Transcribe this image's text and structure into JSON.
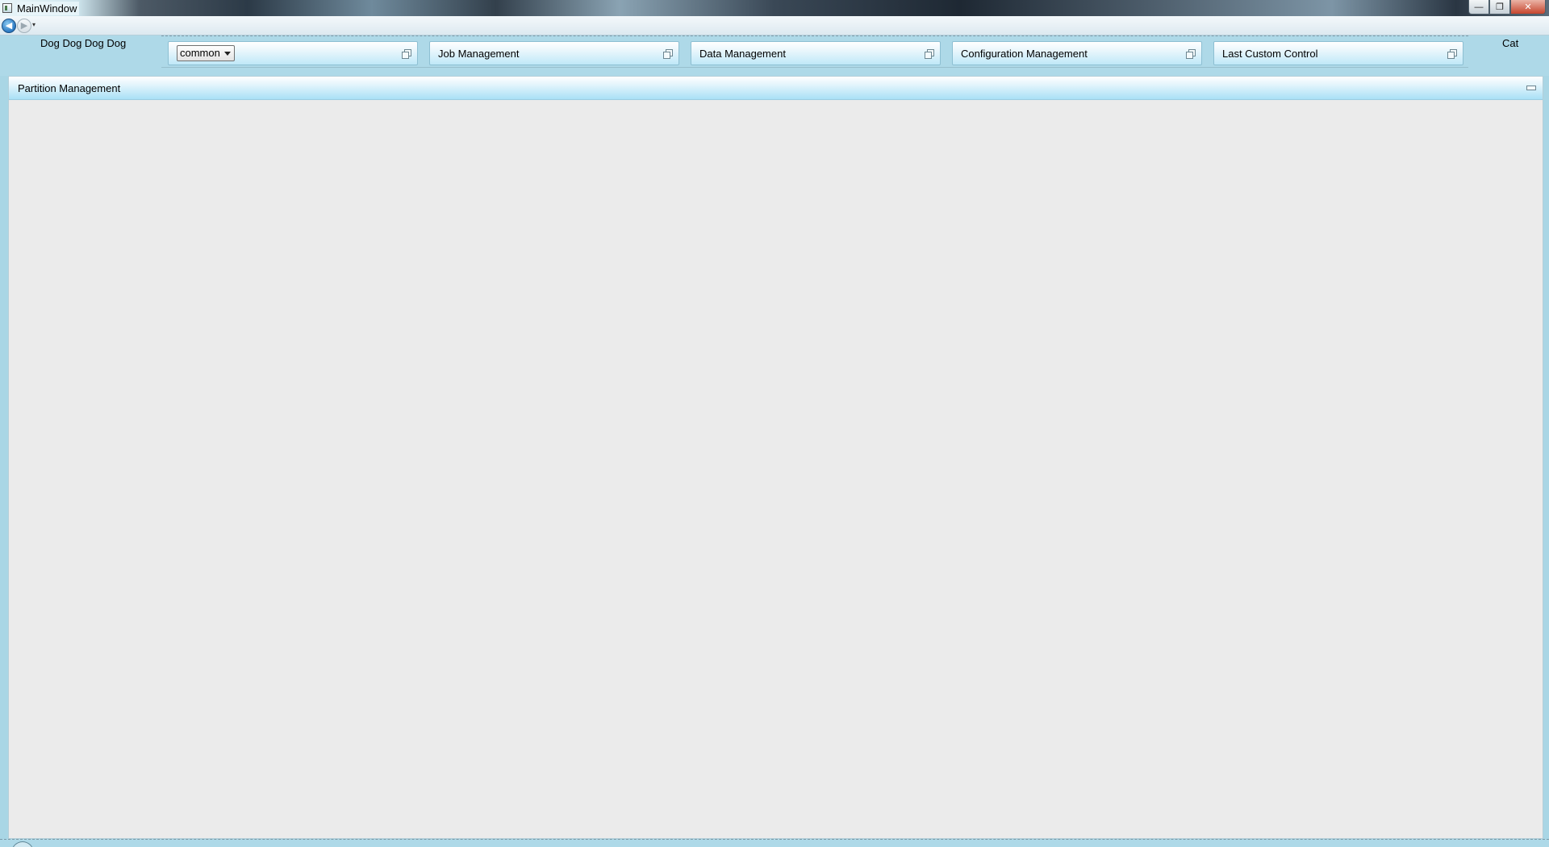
{
  "window": {
    "title": "MainWindow",
    "controls": {
      "minimize": "—",
      "maximize": "❐",
      "close": "✕"
    }
  },
  "nav": {
    "back_glyph": "◀",
    "forward_glyph": "▶",
    "history_glyph": "▾"
  },
  "header": {
    "left_label": "Dog Dog Dog Dog",
    "right_label": "Cat"
  },
  "tiles": [
    {
      "select_value": "common"
    },
    {
      "label": "Job Management"
    },
    {
      "label": "Data Management"
    },
    {
      "label": "Configuration Management"
    },
    {
      "label": "Last Custom Control"
    }
  ],
  "panel": {
    "title": "Partition Management"
  }
}
